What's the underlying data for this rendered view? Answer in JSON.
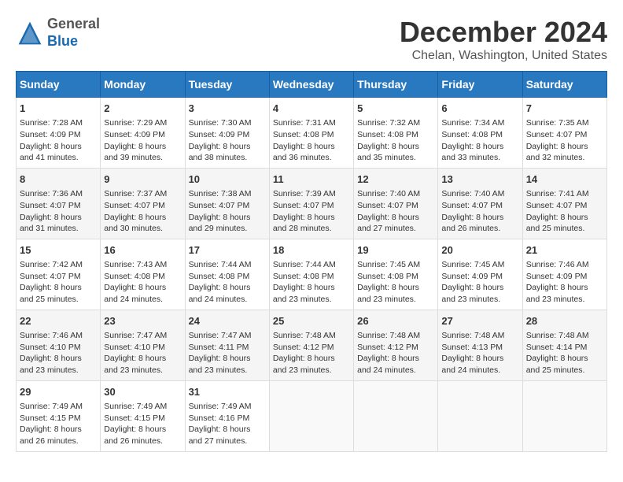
{
  "header": {
    "logo_line1": "General",
    "logo_line2": "Blue",
    "month": "December 2024",
    "location": "Chelan, Washington, United States"
  },
  "days_of_week": [
    "Sunday",
    "Monday",
    "Tuesday",
    "Wednesday",
    "Thursday",
    "Friday",
    "Saturday"
  ],
  "weeks": [
    [
      {
        "day": "1",
        "sunrise": "Sunrise: 7:28 AM",
        "sunset": "Sunset: 4:09 PM",
        "daylight": "Daylight: 8 hours and 41 minutes."
      },
      {
        "day": "2",
        "sunrise": "Sunrise: 7:29 AM",
        "sunset": "Sunset: 4:09 PM",
        "daylight": "Daylight: 8 hours and 39 minutes."
      },
      {
        "day": "3",
        "sunrise": "Sunrise: 7:30 AM",
        "sunset": "Sunset: 4:09 PM",
        "daylight": "Daylight: 8 hours and 38 minutes."
      },
      {
        "day": "4",
        "sunrise": "Sunrise: 7:31 AM",
        "sunset": "Sunset: 4:08 PM",
        "daylight": "Daylight: 8 hours and 36 minutes."
      },
      {
        "day": "5",
        "sunrise": "Sunrise: 7:32 AM",
        "sunset": "Sunset: 4:08 PM",
        "daylight": "Daylight: 8 hours and 35 minutes."
      },
      {
        "day": "6",
        "sunrise": "Sunrise: 7:34 AM",
        "sunset": "Sunset: 4:08 PM",
        "daylight": "Daylight: 8 hours and 33 minutes."
      },
      {
        "day": "7",
        "sunrise": "Sunrise: 7:35 AM",
        "sunset": "Sunset: 4:07 PM",
        "daylight": "Daylight: 8 hours and 32 minutes."
      }
    ],
    [
      {
        "day": "8",
        "sunrise": "Sunrise: 7:36 AM",
        "sunset": "Sunset: 4:07 PM",
        "daylight": "Daylight: 8 hours and 31 minutes."
      },
      {
        "day": "9",
        "sunrise": "Sunrise: 7:37 AM",
        "sunset": "Sunset: 4:07 PM",
        "daylight": "Daylight: 8 hours and 30 minutes."
      },
      {
        "day": "10",
        "sunrise": "Sunrise: 7:38 AM",
        "sunset": "Sunset: 4:07 PM",
        "daylight": "Daylight: 8 hours and 29 minutes."
      },
      {
        "day": "11",
        "sunrise": "Sunrise: 7:39 AM",
        "sunset": "Sunset: 4:07 PM",
        "daylight": "Daylight: 8 hours and 28 minutes."
      },
      {
        "day": "12",
        "sunrise": "Sunrise: 7:40 AM",
        "sunset": "Sunset: 4:07 PM",
        "daylight": "Daylight: 8 hours and 27 minutes."
      },
      {
        "day": "13",
        "sunrise": "Sunrise: 7:40 AM",
        "sunset": "Sunset: 4:07 PM",
        "daylight": "Daylight: 8 hours and 26 minutes."
      },
      {
        "day": "14",
        "sunrise": "Sunrise: 7:41 AM",
        "sunset": "Sunset: 4:07 PM",
        "daylight": "Daylight: 8 hours and 25 minutes."
      }
    ],
    [
      {
        "day": "15",
        "sunrise": "Sunrise: 7:42 AM",
        "sunset": "Sunset: 4:07 PM",
        "daylight": "Daylight: 8 hours and 25 minutes."
      },
      {
        "day": "16",
        "sunrise": "Sunrise: 7:43 AM",
        "sunset": "Sunset: 4:08 PM",
        "daylight": "Daylight: 8 hours and 24 minutes."
      },
      {
        "day": "17",
        "sunrise": "Sunrise: 7:44 AM",
        "sunset": "Sunset: 4:08 PM",
        "daylight": "Daylight: 8 hours and 24 minutes."
      },
      {
        "day": "18",
        "sunrise": "Sunrise: 7:44 AM",
        "sunset": "Sunset: 4:08 PM",
        "daylight": "Daylight: 8 hours and 23 minutes."
      },
      {
        "day": "19",
        "sunrise": "Sunrise: 7:45 AM",
        "sunset": "Sunset: 4:08 PM",
        "daylight": "Daylight: 8 hours and 23 minutes."
      },
      {
        "day": "20",
        "sunrise": "Sunrise: 7:45 AM",
        "sunset": "Sunset: 4:09 PM",
        "daylight": "Daylight: 8 hours and 23 minutes."
      },
      {
        "day": "21",
        "sunrise": "Sunrise: 7:46 AM",
        "sunset": "Sunset: 4:09 PM",
        "daylight": "Daylight: 8 hours and 23 minutes."
      }
    ],
    [
      {
        "day": "22",
        "sunrise": "Sunrise: 7:46 AM",
        "sunset": "Sunset: 4:10 PM",
        "daylight": "Daylight: 8 hours and 23 minutes."
      },
      {
        "day": "23",
        "sunrise": "Sunrise: 7:47 AM",
        "sunset": "Sunset: 4:10 PM",
        "daylight": "Daylight: 8 hours and 23 minutes."
      },
      {
        "day": "24",
        "sunrise": "Sunrise: 7:47 AM",
        "sunset": "Sunset: 4:11 PM",
        "daylight": "Daylight: 8 hours and 23 minutes."
      },
      {
        "day": "25",
        "sunrise": "Sunrise: 7:48 AM",
        "sunset": "Sunset: 4:12 PM",
        "daylight": "Daylight: 8 hours and 23 minutes."
      },
      {
        "day": "26",
        "sunrise": "Sunrise: 7:48 AM",
        "sunset": "Sunset: 4:12 PM",
        "daylight": "Daylight: 8 hours and 24 minutes."
      },
      {
        "day": "27",
        "sunrise": "Sunrise: 7:48 AM",
        "sunset": "Sunset: 4:13 PM",
        "daylight": "Daylight: 8 hours and 24 minutes."
      },
      {
        "day": "28",
        "sunrise": "Sunrise: 7:48 AM",
        "sunset": "Sunset: 4:14 PM",
        "daylight": "Daylight: 8 hours and 25 minutes."
      }
    ],
    [
      {
        "day": "29",
        "sunrise": "Sunrise: 7:49 AM",
        "sunset": "Sunset: 4:15 PM",
        "daylight": "Daylight: 8 hours and 26 minutes."
      },
      {
        "day": "30",
        "sunrise": "Sunrise: 7:49 AM",
        "sunset": "Sunset: 4:15 PM",
        "daylight": "Daylight: 8 hours and 26 minutes."
      },
      {
        "day": "31",
        "sunrise": "Sunrise: 7:49 AM",
        "sunset": "Sunset: 4:16 PM",
        "daylight": "Daylight: 8 hours and 27 minutes."
      },
      null,
      null,
      null,
      null
    ]
  ]
}
